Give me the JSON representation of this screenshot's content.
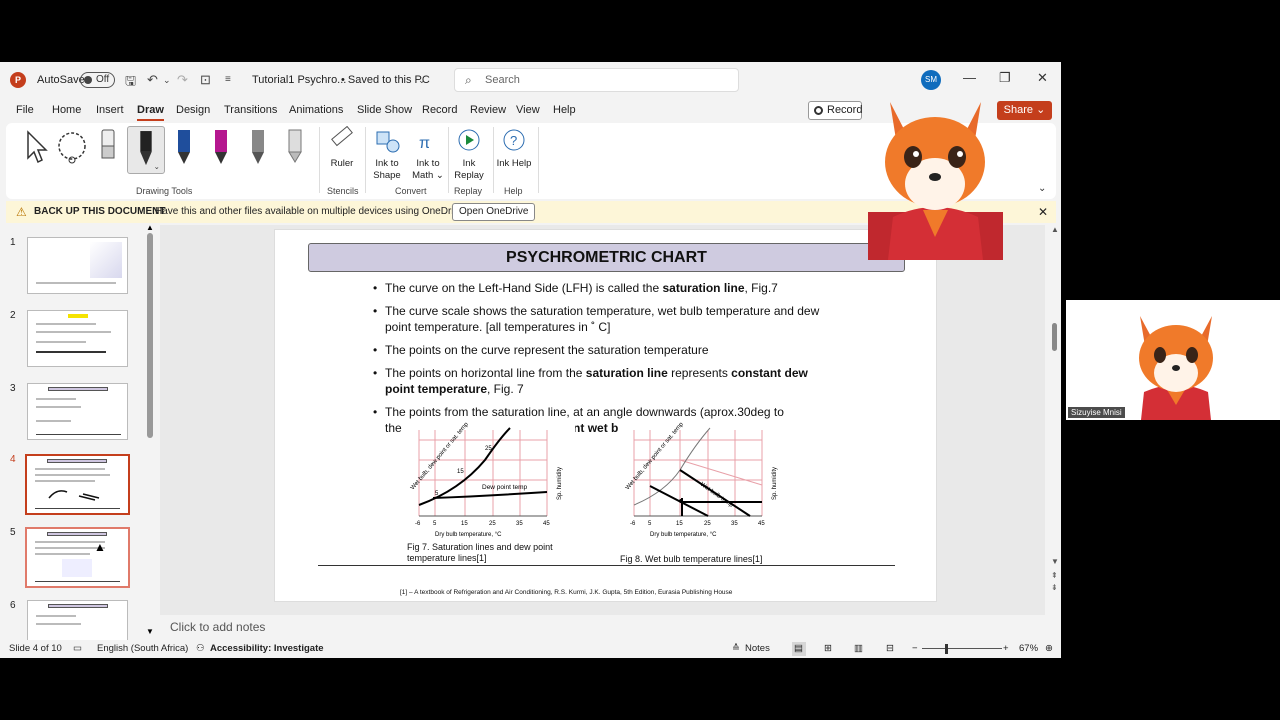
{
  "titlebar": {
    "app_icon": "P",
    "autosave_label": "AutoSave",
    "autosave_state": "Off",
    "doc_name": "Tutorial1 Psychro...",
    "save_status": "• Saved to this PC",
    "search_placeholder": "Search",
    "user_initials": "SM"
  },
  "menu": {
    "items": [
      "File",
      "Home",
      "Insert",
      "Draw",
      "Design",
      "Transitions",
      "Animations",
      "Slide Show",
      "Record",
      "Review",
      "View",
      "Help"
    ],
    "active": "Draw",
    "record_label": "Record",
    "share_label": "Share"
  },
  "ribbon": {
    "drawing_tools_label": "Drawing Tools",
    "stencils_label": "Stencils",
    "convert_label": "Convert",
    "replay_label": "Replay",
    "help_label": "Help",
    "ruler": "Ruler",
    "ink_to_shape": "Ink to Shape",
    "ink_to_math": "Ink to Math",
    "ink_replay": "Ink Replay",
    "ink_help": "Ink Help"
  },
  "notification": {
    "title": "BACK UP THIS DOCUMENT",
    "message": "Have this and other files available on multiple devices using OneDrive.",
    "button": "Open OneDrive"
  },
  "thumbnails": {
    "numbers": [
      "1",
      "2",
      "3",
      "4",
      "5",
      "6"
    ],
    "current": 4
  },
  "slide": {
    "title": "PSYCHROMETRIC CHART",
    "b1_pre": "The curve on the Left-Hand Side (LFH) is called the ",
    "b1_bold": "saturation line",
    "b1_post": ", Fig.7",
    "b2": "The curve scale shows the saturation temperature, wet bulb temperature and dew point temperature. [all temperatures in ˚ C]",
    "b3": "The points on the curve represent the saturation temperature",
    "b4_pre": "The points on horizontal line  from the ",
    "b4_bold1": "saturation line",
    "b4_mid": " represents ",
    "b4_bold2": "constant dew point temperature",
    "b4_post": ", Fig. 7",
    "b5_line1": "The points from the saturation line, at an angle downwards (aprox.30deg to",
    "b5_start": "the",
    "b5_bold": "stant wet b",
    "fig7_caption": "Fig 7. Saturation lines and dew point temperature lines[1]",
    "fig8_caption": "Fig 8. Wet bulb temperature lines[1]",
    "fig7_curve_label": "Wet bulb, dew point or sat. temp",
    "fig7_line_label": "Dew point temp",
    "fig7_x_label": "Dry bulb temperature, °C",
    "fig8_x_label": "Dry bulb temperature, °C",
    "fig_y_label": "Sp. humidity",
    "fig8_line_label": "Wet bulb temp",
    "fig8_curve_label": "Wet bulb, dew point or sat. temp",
    "x_ticks": [
      "-6",
      "5",
      "15",
      "25",
      "35",
      "45"
    ],
    "curve_ticks": [
      "5",
      "15",
      "25"
    ],
    "reference": "[1] – A textbook of Refrigeration and Air Conditioning, R.S. Kurmi, J.K. Gupta, 5th Edition, Eurasia Publishing House"
  },
  "notes_placeholder": "Click to add notes",
  "status": {
    "slide_info": "Slide 4 of 10",
    "language": "English (South Africa)",
    "accessibility": "Accessibility: Investigate",
    "notes": "Notes",
    "zoom": "67%"
  },
  "video": {
    "participant_name": "Sizuyise Mnisi"
  }
}
